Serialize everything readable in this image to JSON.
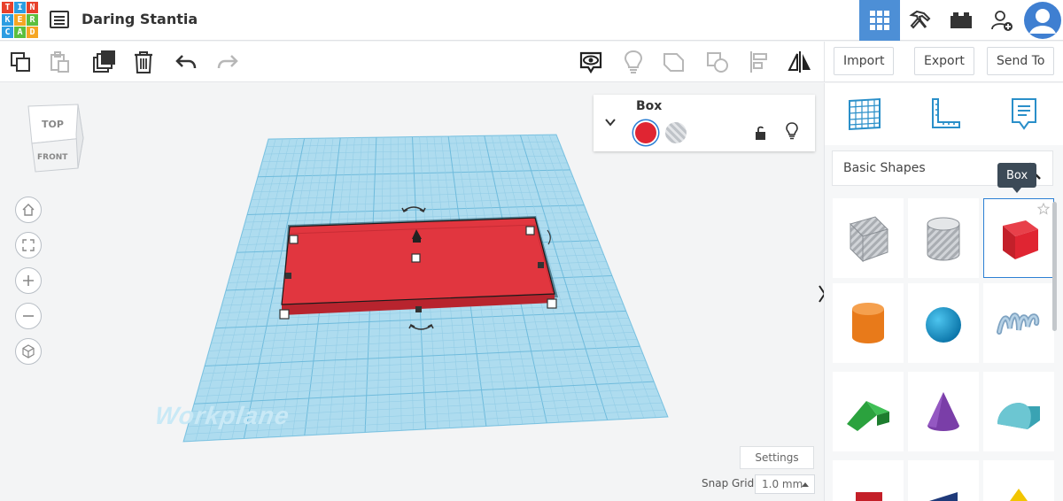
{
  "app": {
    "logo_letters": [
      "T",
      "I",
      "N",
      "K",
      "E",
      "R",
      "C",
      "A",
      "D"
    ],
    "design_title": "Daring Stantia"
  },
  "toolbar_right": {
    "import_label": "Import",
    "export_label": "Export",
    "send_to_label": "Send To"
  },
  "viewcube": {
    "top_label": "TOP",
    "front_label": "FRONT"
  },
  "workplane": {
    "label": "Workplane"
  },
  "inspector": {
    "shape_title": "Box",
    "solid_color": "#e02532"
  },
  "bottom": {
    "settings_label": "Settings",
    "snap_grid_label": "Snap Grid",
    "snap_grid_value": "1.0 mm"
  },
  "panel": {
    "category_label": "Basic Shapes",
    "tooltip": "Box"
  },
  "colors": {
    "accent": "#4d8fd6",
    "selection": "#2c7fd4",
    "workplane": "#aedcef",
    "box_red": "#e02532"
  }
}
